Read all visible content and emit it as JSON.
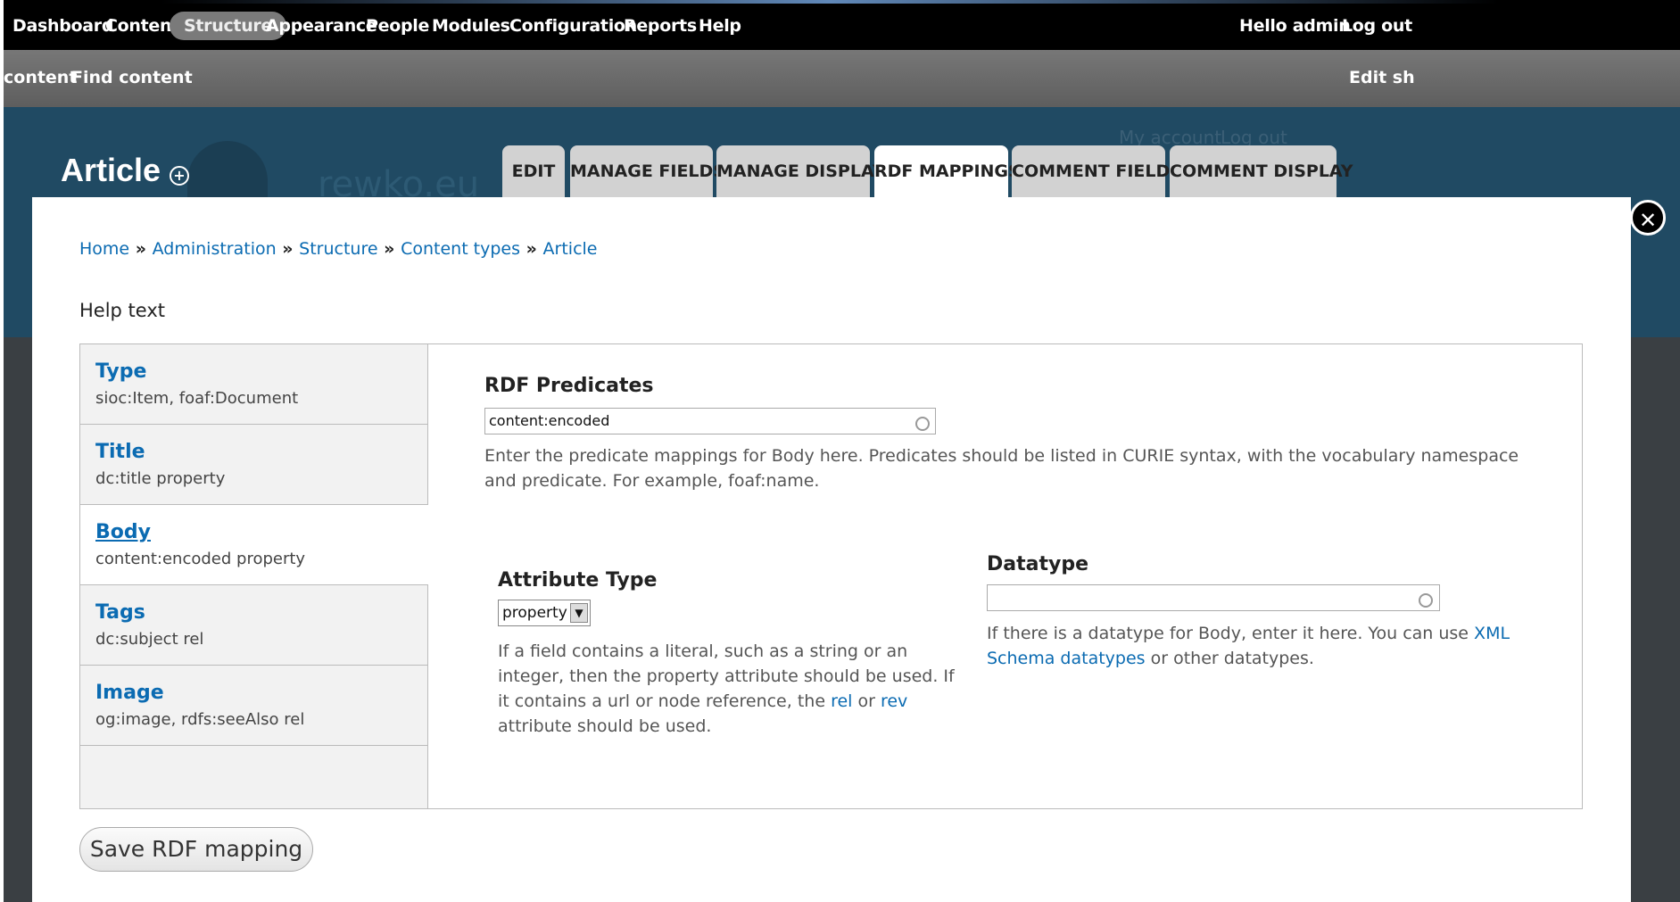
{
  "toolbar": {
    "menu": [
      "Dashboard",
      "Content",
      "Structure",
      "Appearance",
      "People",
      "Modules",
      "Configuration",
      "Reports",
      "Help"
    ],
    "active": "Structure",
    "greeting": "Hello",
    "username": "admin",
    "logout": "Log out"
  },
  "shortcuts": {
    "items": [
      "content",
      "Find content"
    ],
    "edit_shortcuts": "Edit sh"
  },
  "background": {
    "my_account": "My account",
    "log_out": "Log out",
    "site_name": "rewko.eu"
  },
  "page": {
    "title": "Article"
  },
  "tabs": [
    {
      "label": "EDIT",
      "active": false
    },
    {
      "label": "MANAGE FIELDS",
      "active": false
    },
    {
      "label": "MANAGE DISPLAY",
      "active": false
    },
    {
      "label": "RDF MAPPINGS",
      "active": true
    },
    {
      "label": "COMMENT FIELDS",
      "active": false
    },
    {
      "label": "COMMENT DISPLAY",
      "active": false
    }
  ],
  "breadcrumb": [
    "Home",
    "Administration",
    "Structure",
    "Content types",
    "Article"
  ],
  "help_text": "Help text",
  "vertical_tabs": [
    {
      "name": "Type",
      "summary": "sioc:Item, foaf:Document",
      "active": false
    },
    {
      "name": "Title",
      "summary": "dc:title property",
      "active": false
    },
    {
      "name": "Body",
      "summary": "content:encoded property",
      "active": true
    },
    {
      "name": "Tags",
      "summary": "dc:subject rel",
      "active": false
    },
    {
      "name": "Image",
      "summary": "og:image, rdfs:seeAlso rel",
      "active": false
    }
  ],
  "panel": {
    "predicates_label": "RDF Predicates",
    "predicates_value": "content:encoded",
    "predicates_desc": "Enter the predicate mappings for Body here. Predicates should be listed in CURIE syntax, with the vocabulary namespace and predicate. For example, foaf:name.",
    "attribute_label": "Attribute Type",
    "attribute_value": "property",
    "attribute_desc_1": "If a field contains a literal, such as a string or an integer, then the property attribute should be used. If it contains a url or node reference, the",
    "attribute_rel": "rel",
    "attribute_or": "or",
    "attribute_rev": "rev",
    "attribute_desc_2": "attribute should be used.",
    "datatype_label": "Datatype",
    "datatype_value": "",
    "datatype_desc_1": "If there is a datatype for Body, enter it here. You can use",
    "datatype_link": "XML Schema datatypes",
    "datatype_desc_2": "or other datatypes."
  },
  "save_button": "Save RDF mapping"
}
